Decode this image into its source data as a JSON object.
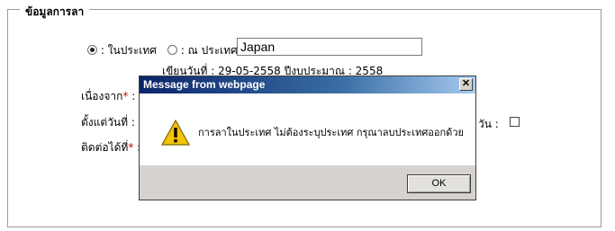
{
  "form": {
    "legend": "ข้อมูลการลา",
    "radio_domestic_label": ": ในประเทศ",
    "radio_abroad_label": ": ณ ประเทศ",
    "country_value": "Japan",
    "date_line": "เขียนวันที่ : 29-05-2558   ปีงบประมาณ : 2558",
    "reason_label": "เนื่องจาก",
    "from_date_label": "ตั้งแต่วันที่ :",
    "contact_label": "ติดต่อได้ที่",
    "contact_suffix": " :",
    "reason_suffix": " :",
    "halfday_label": "วัน :",
    "required_mark": "*"
  },
  "dialog": {
    "title": "Message from webpage",
    "message": "การลาในประเทศ ไม่ต้องระบุประเทศ กรุณาลบประเทศออกด้วย",
    "ok_label": "OK",
    "close_glyph": "✕"
  },
  "colors": {
    "titlebar_start": "#0a246a",
    "titlebar_end": "#a6caf0",
    "required": "#d00000",
    "warning_icon": "#f5c400"
  }
}
